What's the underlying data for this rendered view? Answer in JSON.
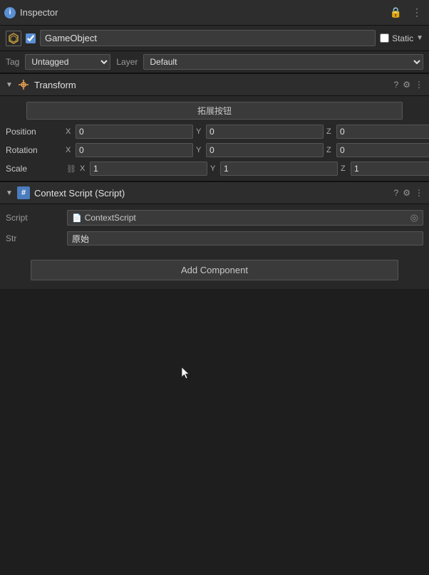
{
  "titleBar": {
    "title": "Inspector",
    "lockIcon": "🔒",
    "menuIcon": "⋮"
  },
  "gameObject": {
    "name": "GameObject",
    "checkbox": true,
    "staticLabel": "Static",
    "iconText": "⬡"
  },
  "tagLayer": {
    "tagLabel": "Tag",
    "tagValue": "Untagged",
    "layerLabel": "Layer",
    "layerValue": "Default"
  },
  "transform": {
    "title": "Transform",
    "expandBtn": "拓展按钮",
    "position": {
      "label": "Position",
      "x": "0",
      "y": "0",
      "z": "0"
    },
    "rotation": {
      "label": "Rotation",
      "x": "0",
      "y": "0",
      "z": "0"
    },
    "scale": {
      "label": "Scale",
      "x": "1",
      "y": "1",
      "z": "1"
    }
  },
  "contextScript": {
    "title": "Context Script (Script)",
    "scriptLabel": "Script",
    "scriptName": "ContextScript",
    "strLabel": "Str",
    "strValue": "原始"
  },
  "addComponent": {
    "label": "Add Component"
  },
  "icons": {
    "questionMark": "?",
    "settings": "⚙",
    "menu": "⋮",
    "arrow": "▶",
    "lock": "🔒",
    "target": "◎"
  }
}
